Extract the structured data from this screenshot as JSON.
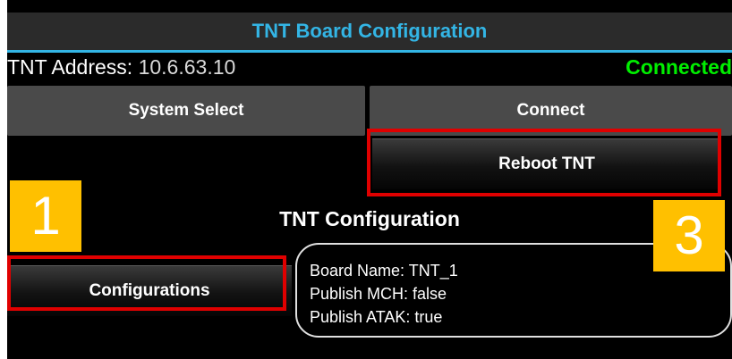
{
  "app": {
    "title": "TNT Board Configuration"
  },
  "connection": {
    "address_label": "TNT Address: ",
    "address_value": "10.6.63.10",
    "status": "Connected"
  },
  "buttons": {
    "system_select": "System Select",
    "connect": "Connect",
    "reboot": "Reboot TNT",
    "configurations": "Configurations"
  },
  "configuration": {
    "section_title": "TNT Configuration",
    "board_name": "Board Name: TNT_1",
    "publish_mch": "Publish MCH: false",
    "publish_atak": "Publish ATAK: true"
  },
  "callouts": {
    "one": "1",
    "three": "3"
  },
  "colors": {
    "accent": "#33b5e5",
    "connected": "#00ee00",
    "highlight": "#e00000",
    "callout": "#ffc000"
  }
}
